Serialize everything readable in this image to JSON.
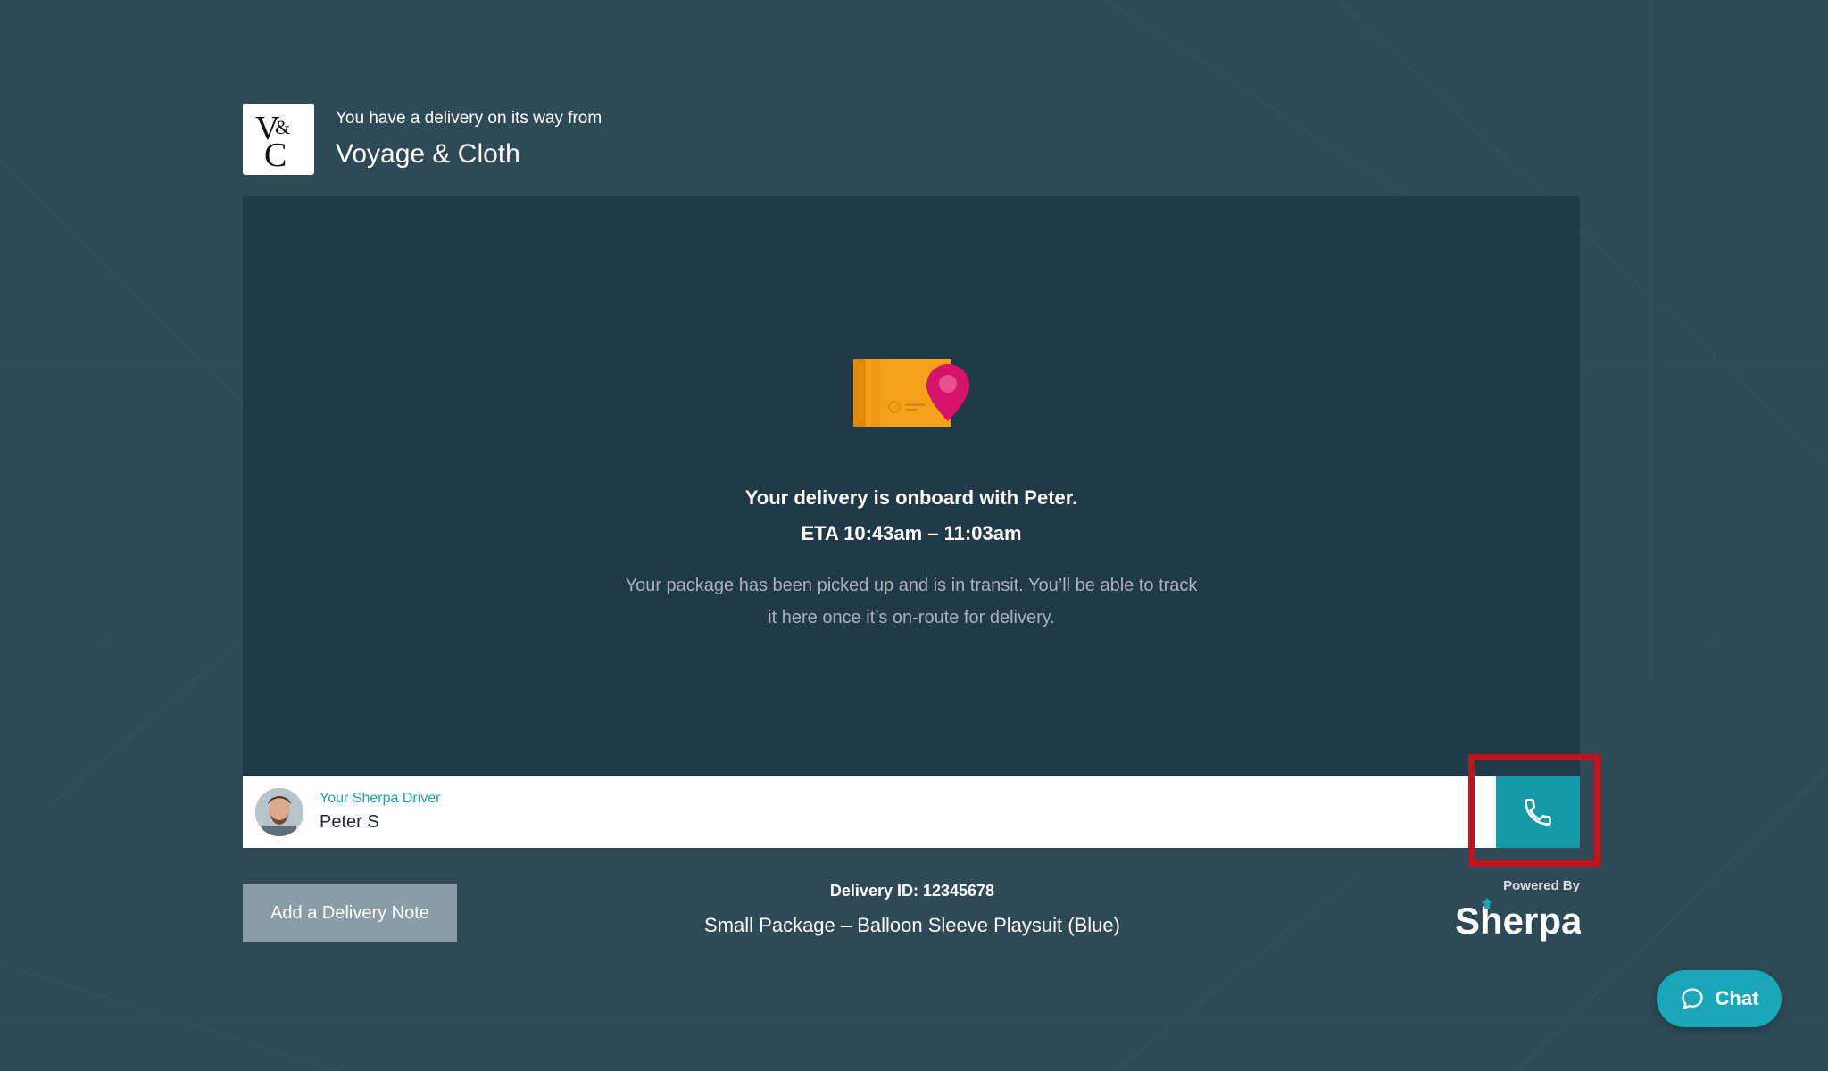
{
  "header": {
    "subtitle": "You have a delivery on its way from",
    "merchant": "Voyage & Cloth",
    "logo_text": "V&C"
  },
  "status": {
    "title": "Your delivery is onboard with Peter.",
    "eta": "ETA 10:43am – 11:03am",
    "description": "Your package has been picked up and is in transit. You’ll be able to track it here once it’s on-route for delivery."
  },
  "driver": {
    "label": "Your Sherpa Driver",
    "name": "Peter S",
    "call_icon": "phone-icon"
  },
  "footer": {
    "note_button": "Add a Delivery Note",
    "delivery_id": "Delivery ID: 12345678",
    "package": "Small Package – Balloon Sleeve Playsuit (Blue)",
    "powered_by": "Powered By",
    "brand": "Sherpa"
  },
  "chat": {
    "label": "Chat",
    "icon": "chat-bubble-icon"
  },
  "colors": {
    "background": "#2e4a57",
    "card": "#213a47",
    "accent": "#149aa9",
    "highlight": "#c0131b",
    "package": "#f6a11a",
    "pin": "#d8146a"
  }
}
